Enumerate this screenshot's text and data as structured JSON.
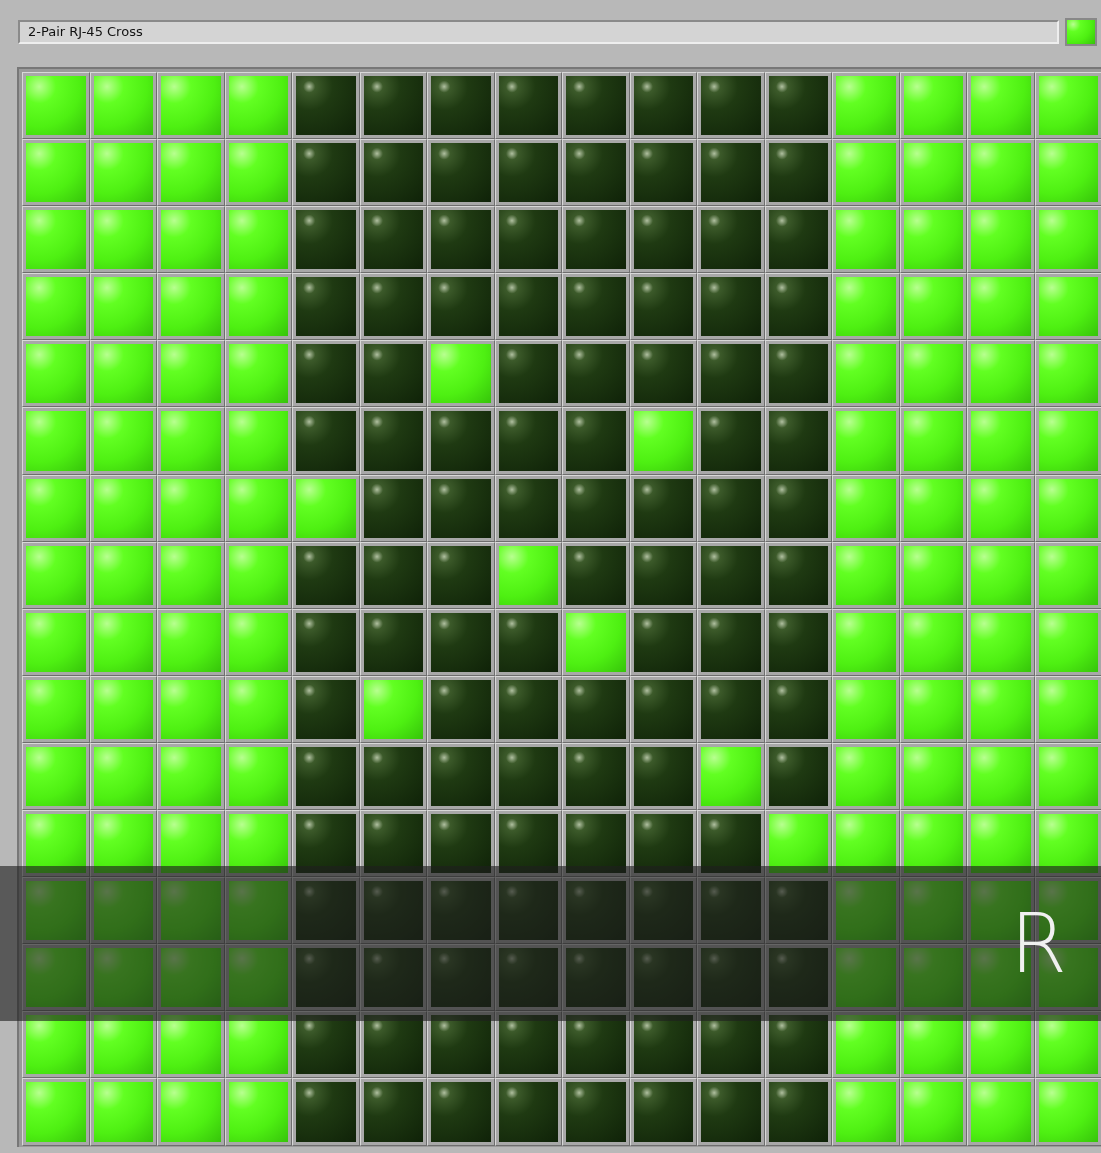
{
  "title_field": {
    "value": "2-Pair RJ-45 Cross"
  },
  "indicator": {
    "on": true
  },
  "grid": {
    "rows": [
      [
        true,
        true,
        true,
        true,
        false,
        false,
        false,
        false,
        false,
        false,
        false,
        false,
        true,
        true,
        true,
        true
      ],
      [
        true,
        true,
        true,
        true,
        false,
        false,
        false,
        false,
        false,
        false,
        false,
        false,
        true,
        true,
        true,
        true
      ],
      [
        true,
        true,
        true,
        true,
        false,
        false,
        false,
        false,
        false,
        false,
        false,
        false,
        true,
        true,
        true,
        true
      ],
      [
        true,
        true,
        true,
        true,
        false,
        false,
        false,
        false,
        false,
        false,
        false,
        false,
        true,
        true,
        true,
        true
      ],
      [
        true,
        true,
        true,
        true,
        false,
        false,
        true,
        false,
        false,
        false,
        false,
        false,
        true,
        true,
        true,
        true
      ],
      [
        true,
        true,
        true,
        true,
        false,
        false,
        false,
        false,
        false,
        true,
        false,
        false,
        true,
        true,
        true,
        true
      ],
      [
        true,
        true,
        true,
        true,
        true,
        false,
        false,
        false,
        false,
        false,
        false,
        false,
        true,
        true,
        true,
        true
      ],
      [
        true,
        true,
        true,
        true,
        false,
        false,
        false,
        true,
        false,
        false,
        false,
        false,
        true,
        true,
        true,
        true
      ],
      [
        true,
        true,
        true,
        true,
        false,
        false,
        false,
        false,
        true,
        false,
        false,
        false,
        true,
        true,
        true,
        true
      ],
      [
        true,
        true,
        true,
        true,
        false,
        true,
        false,
        false,
        false,
        false,
        false,
        false,
        true,
        true,
        true,
        true
      ],
      [
        true,
        true,
        true,
        true,
        false,
        false,
        false,
        false,
        false,
        false,
        true,
        false,
        true,
        true,
        true,
        true
      ],
      [
        true,
        true,
        true,
        true,
        false,
        false,
        false,
        false,
        false,
        false,
        false,
        true,
        true,
        true,
        true,
        true
      ],
      [
        true,
        true,
        true,
        true,
        false,
        false,
        false,
        false,
        false,
        false,
        false,
        false,
        true,
        true,
        true,
        true
      ],
      [
        true,
        true,
        true,
        true,
        false,
        false,
        false,
        false,
        false,
        false,
        false,
        false,
        true,
        true,
        true,
        true
      ],
      [
        true,
        true,
        true,
        true,
        false,
        false,
        false,
        false,
        false,
        false,
        false,
        false,
        true,
        true,
        true,
        true
      ],
      [
        true,
        true,
        true,
        true,
        false,
        false,
        false,
        false,
        false,
        false,
        false,
        false,
        true,
        true,
        true,
        true
      ]
    ]
  },
  "overlay_caption": {
    "text": "R"
  }
}
